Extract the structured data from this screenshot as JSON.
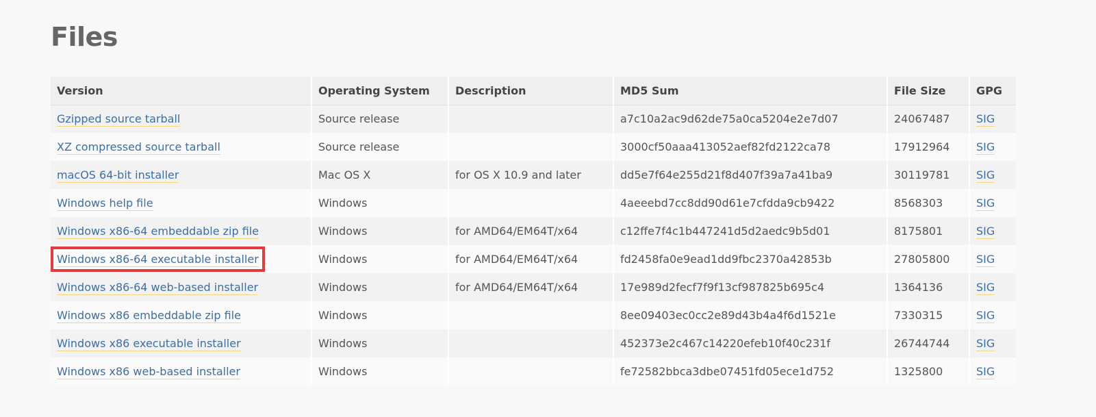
{
  "page": {
    "title": "Files"
  },
  "table": {
    "headers": [
      "Version",
      "Operating System",
      "Description",
      "MD5 Sum",
      "File Size",
      "GPG"
    ],
    "rows": [
      {
        "version": "Gzipped source tarball",
        "os": "Source release",
        "description": "",
        "md5": "a7c10a2ac9d62de75a0ca5204e2e7d07",
        "size": "24067487",
        "gpg": "SIG"
      },
      {
        "version": "XZ compressed source tarball",
        "os": "Source release",
        "description": "",
        "md5": "3000cf50aaa413052aef82fd2122ca78",
        "size": "17912964",
        "gpg": "SIG"
      },
      {
        "version": "macOS 64-bit installer",
        "os": "Mac OS X",
        "description": "for OS X 10.9 and later",
        "md5": "dd5e7f64e255d21f8d407f39a7a41ba9",
        "size": "30119781",
        "gpg": "SIG"
      },
      {
        "version": "Windows help file",
        "os": "Windows",
        "description": "",
        "md5": "4aeeebd7cc8dd90d61e7cfdda9cb9422",
        "size": "8568303",
        "gpg": "SIG"
      },
      {
        "version": "Windows x86-64 embeddable zip file",
        "os": "Windows",
        "description": "for AMD64/EM64T/x64",
        "md5": "c12ffe7f4c1b447241d5d2aedc9b5d01",
        "size": "8175801",
        "gpg": "SIG"
      },
      {
        "version": "Windows x86-64 executable installer",
        "os": "Windows",
        "description": "for AMD64/EM64T/x64",
        "md5": "fd2458fa0e9ead1dd9fbc2370a42853b",
        "size": "27805800",
        "gpg": "SIG"
      },
      {
        "version": "Windows x86-64 web-based installer",
        "os": "Windows",
        "description": "for AMD64/EM64T/x64",
        "md5": "17e989d2fecf7f9f13cf987825b695c4",
        "size": "1364136",
        "gpg": "SIG"
      },
      {
        "version": "Windows x86 embeddable zip file",
        "os": "Windows",
        "description": "",
        "md5": "8ee09403ec0cc2e89d43b4a4f6d1521e",
        "size": "7330315",
        "gpg": "SIG"
      },
      {
        "version": "Windows x86 executable installer",
        "os": "Windows",
        "description": "",
        "md5": "452373e2c467c14220efeb10f40c231f",
        "size": "26744744",
        "gpg": "SIG"
      },
      {
        "version": "Windows x86 web-based installer",
        "os": "Windows",
        "description": "",
        "md5": "fe72582bbca3dbe07451fd05ece1d752",
        "size": "1325800",
        "gpg": "SIG"
      }
    ]
  },
  "colors": {
    "link": "#3d6ea5",
    "link_underline": "#f4d580",
    "highlight_box": "#e8393a",
    "header_bg": "#efefef",
    "row_odd_bg": "#f2f2f2",
    "row_even_bg": "#fafafa",
    "title": "#666666"
  }
}
